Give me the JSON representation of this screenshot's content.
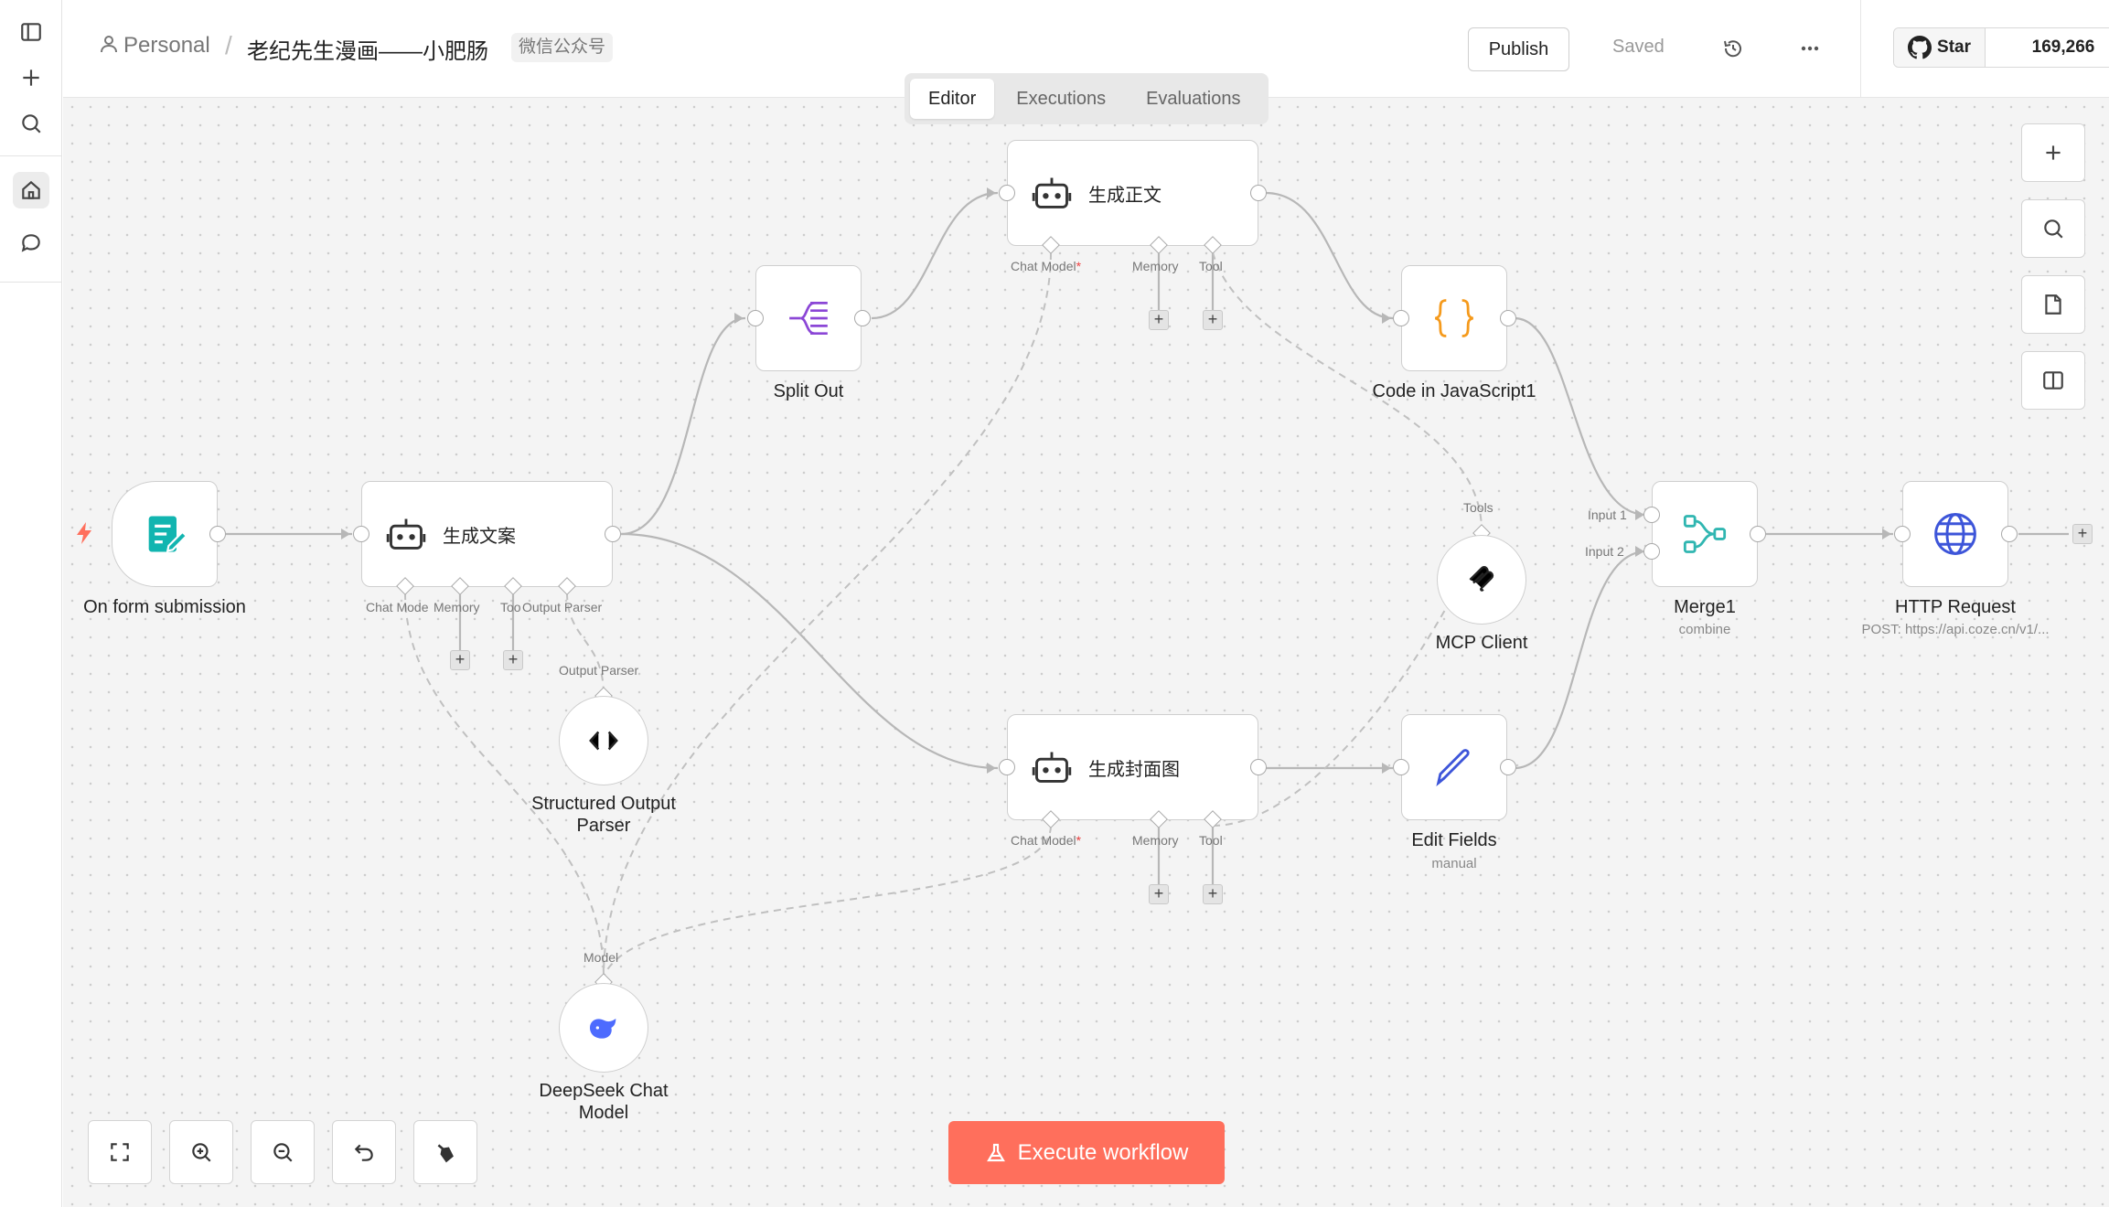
{
  "header": {
    "project": "Personal",
    "title": "老纪先生漫画——小肥肠",
    "tag": "微信公众号",
    "publish_label": "Publish",
    "saved_label": "Saved",
    "github_star_label": "Star",
    "github_star_count": "169,266"
  },
  "tabs": [
    {
      "label": "Editor",
      "active": true
    },
    {
      "label": "Executions",
      "active": false
    },
    {
      "label": "Evaluations",
      "active": false
    }
  ],
  "nodes": {
    "form_trigger": {
      "label": "On form submission",
      "icon": "form-icon",
      "color": "#12b5b0"
    },
    "agent_copy": {
      "title": "生成文案",
      "icon": "robot-icon"
    },
    "split_out": {
      "label": "Split Out",
      "icon": "split-icon",
      "color": "#8b46d6"
    },
    "agent_body": {
      "title": "生成正文",
      "icon": "robot-icon"
    },
    "code_js": {
      "label": "Code in JavaScript1",
      "icon": "braces-icon",
      "color": "#f59a1c"
    },
    "mcp_client": {
      "label": "MCP Client",
      "icon": "mcp-icon"
    },
    "merge": {
      "label": "Merge1",
      "sub": "combine",
      "icon": "merge-icon",
      "color": "#30b6b1"
    },
    "http_request": {
      "label": "HTTP Request",
      "sub": "POST: https://api.coze.cn/v1/...",
      "icon": "globe-icon",
      "color": "#3d55d9"
    },
    "parser": {
      "label_line1": "Structured Output",
      "label_line2": "Parser",
      "icon": "code-brackets-icon"
    },
    "agent_cover": {
      "title": "生成封面图",
      "icon": "robot-icon"
    },
    "edit_fields": {
      "label": "Edit Fields",
      "sub": "manual",
      "icon": "pencil-icon",
      "color": "#3d55d9"
    },
    "deepseek": {
      "label_line1": "DeepSeek Chat",
      "label_line2": "Model",
      "icon": "deepseek-whale-icon",
      "color": "#4d6bfe"
    }
  },
  "ports": {
    "chat_model": "Chat Model",
    "chat_model_short": "Chat Mode",
    "memory": "Memory",
    "tool": "Tool",
    "tool_short": "Too",
    "output_parser": "Output Parser",
    "tools": "Tools",
    "model": "Model",
    "input1": "Input 1",
    "input2": "Input 2",
    "required_mark": "*"
  },
  "execute_label": "Execute workflow",
  "colors": {
    "accent": "#ff6f5c",
    "edge": "#b7b7b7"
  }
}
